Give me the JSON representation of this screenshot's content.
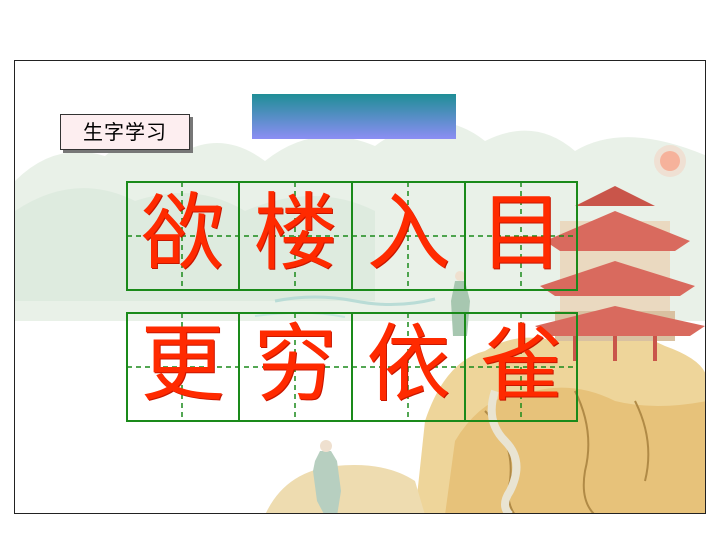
{
  "lesson": {
    "label": "生字学习"
  },
  "characters": {
    "row1": [
      "欲",
      "楼",
      "入",
      "目"
    ],
    "row2": [
      "更",
      "穷",
      "依",
      "雀"
    ]
  },
  "colors": {
    "character": "#ff2a00",
    "grid_line": "#1a8a1a",
    "title_bar_top": "#1f8e96",
    "title_bar_bottom": "#8c8ef4"
  }
}
